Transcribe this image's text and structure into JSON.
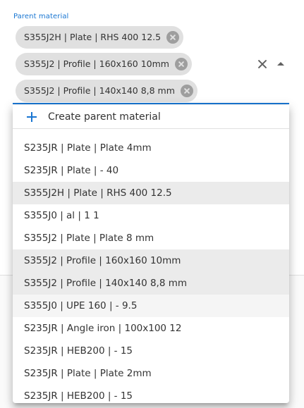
{
  "field": {
    "label": "Parent material",
    "chips": [
      {
        "label": "S355J2H | Plate | RHS 400 12.5"
      },
      {
        "label": "S355J2 | Profile | 160x160 10mm"
      },
      {
        "label": "S355J2 | Profile | 140x140 8,8 mm"
      }
    ]
  },
  "dropdown": {
    "create_label": "Create parent material",
    "options": [
      {
        "label": "S235JR | Plate | Plate 4mm",
        "state": "normal"
      },
      {
        "label": "S235JR | Plate | - 40",
        "state": "normal"
      },
      {
        "label": "S355J2H | Plate | RHS 400 12.5",
        "state": "selected"
      },
      {
        "label": "S355J0 | al | 1 1",
        "state": "normal"
      },
      {
        "label": "S355J2 | Plate | Plate 8 mm",
        "state": "normal"
      },
      {
        "label": "S355J2 | Profile | 160x160 10mm",
        "state": "selected"
      },
      {
        "label": "S355J2 | Profile | 140x140 8,8 mm",
        "state": "selected"
      },
      {
        "label": "S355J0 | UPE 160 | - 9.5",
        "state": "focused"
      },
      {
        "label": "S235JR | Angle iron | 100x100 12",
        "state": "normal"
      },
      {
        "label": "S235JR | HEB200 | - 15",
        "state": "normal"
      },
      {
        "label": "S235JR | Plate | Plate 2mm",
        "state": "normal"
      },
      {
        "label": "S235JR | HEB200 | - 15",
        "state": "normal"
      }
    ]
  },
  "colors": {
    "accent": "#1976d2",
    "chip_bg": "#e0e0e0",
    "selected_bg": "#ebebeb",
    "focused_bg": "#f5f5f5"
  },
  "icons": {
    "chip_delete": "cancel-circle-icon",
    "clear": "close-icon",
    "popup": "arrow-drop-up-icon",
    "create": "plus-icon"
  }
}
